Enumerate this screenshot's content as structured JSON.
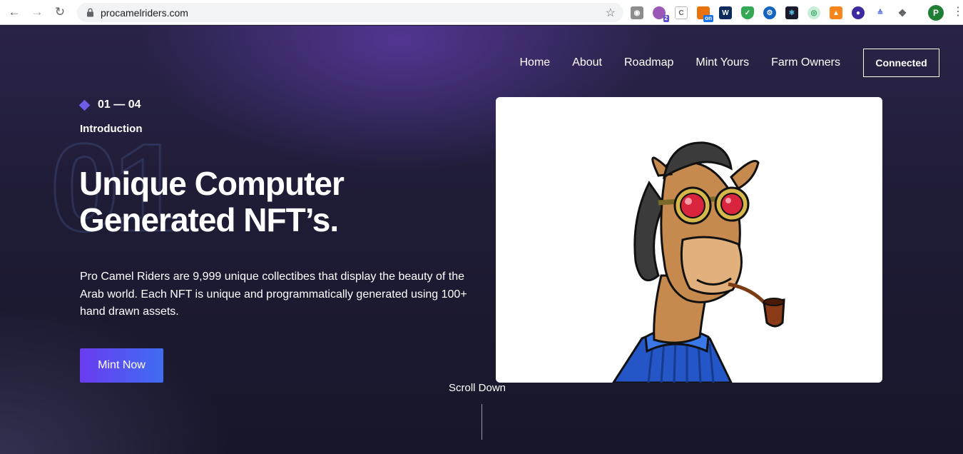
{
  "browser": {
    "url": "procamelriders.com",
    "extension_badges": {
      "ext2": "2",
      "ext4": "on"
    },
    "profile_initial": "P"
  },
  "nav": {
    "home": "Home",
    "about": "About",
    "roadmap": "Roadmap",
    "mint": "Mint Yours",
    "farm": "Farm Owners",
    "wallet_button": "Connected"
  },
  "hero": {
    "counter": "01 — 04",
    "section": "Introduction",
    "background_number": "01",
    "headline_line1": "Unique Computer",
    "headline_line2": "Generated NFT’s.",
    "description": "Pro Camel Riders are 9,999 unique collectibes that display the beauty of the Arab world. Each NFT is unique and programmatically generated using 100+ hand drawn assets.",
    "cta": "Mint Now",
    "scroll_label": "Scroll Down"
  },
  "colors": {
    "accent": "#6c5ce7",
    "button_from": "#6a3cf0",
    "button_to": "#3f6df2",
    "page_bg": "#1f1c36"
  }
}
